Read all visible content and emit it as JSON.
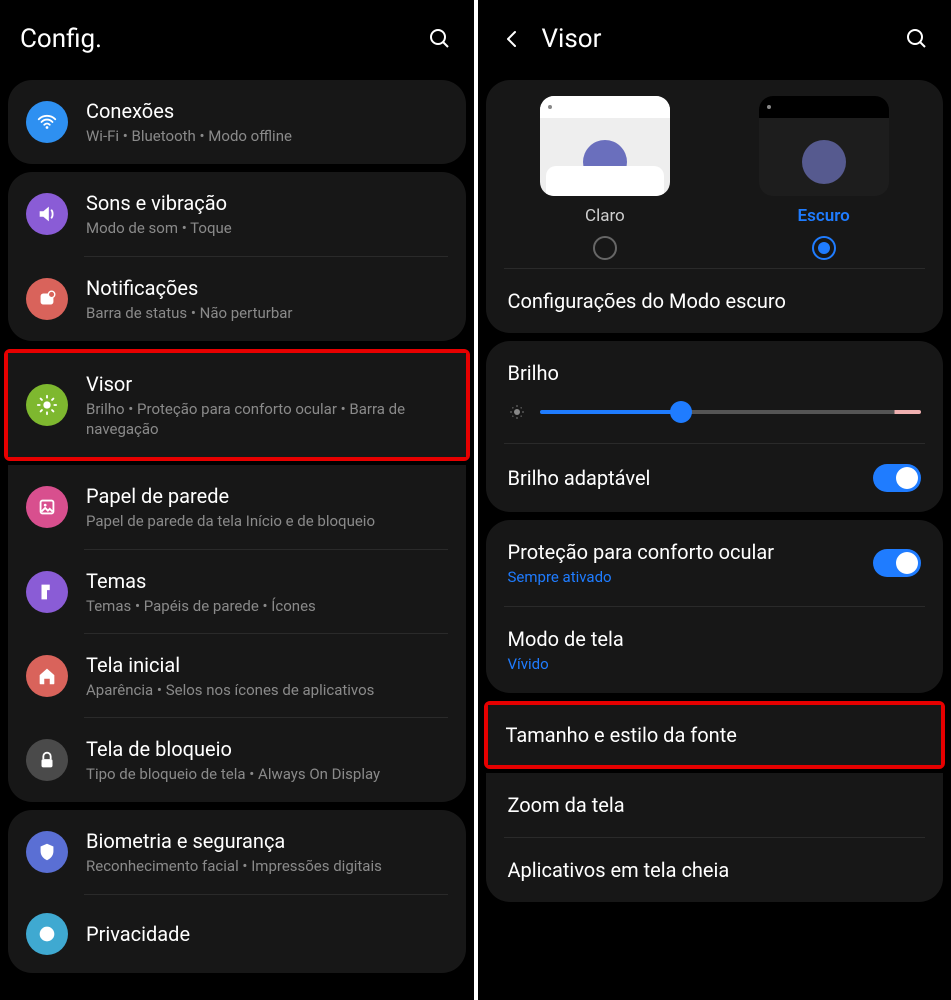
{
  "left": {
    "title": "Config.",
    "groups": [
      {
        "items": [
          {
            "icon": "wifi",
            "color": "#2e90f1",
            "title": "Conexões",
            "sub": "Wi-Fi  •  Bluetooth  •  Modo offline"
          }
        ]
      },
      {
        "items": [
          {
            "icon": "sound",
            "color": "#8a5cd6",
            "title": "Sons e vibração",
            "sub": "Modo de som  •  Toque"
          },
          {
            "icon": "notif",
            "color": "#d9635b",
            "title": "Notificações",
            "sub": "Barra de status  •  Não perturbar"
          }
        ]
      },
      {
        "highlight_index": 0,
        "items": [
          {
            "icon": "display",
            "color": "#7eb82f",
            "title": "Visor",
            "sub": "Brilho  •  Proteção para conforto ocular  •  Barra de navegação"
          },
          {
            "icon": "wallpaper",
            "color": "#d84f8e",
            "title": "Papel de parede",
            "sub": "Papel de parede da tela Início e de bloqueio"
          },
          {
            "icon": "themes",
            "color": "#8a5cd6",
            "title": "Temas",
            "sub": "Temas  •  Papéis de parede  •  Ícones"
          },
          {
            "icon": "home",
            "color": "#d9635b",
            "title": "Tela inicial",
            "sub": "Aparência  •  Selos nos ícones de aplicativos"
          },
          {
            "icon": "lock",
            "color": "#4a4a4a",
            "title": "Tela de bloqueio",
            "sub": "Tipo de bloqueio de tela  •  Always On Display"
          }
        ]
      },
      {
        "items": [
          {
            "icon": "shield",
            "color": "#5a6fd4",
            "title": "Biometria e segurança",
            "sub": "Reconhecimento facial  •  Impressões digitais"
          },
          {
            "icon": "privacy",
            "color": "#3fa9d1",
            "title": "Privacidade",
            "sub": ""
          }
        ]
      }
    ]
  },
  "right": {
    "title": "Visor",
    "theme": {
      "light_label": "Claro",
      "dark_label": "Escuro",
      "selected": "dark"
    },
    "dark_mode_settings": "Configurações do Modo escuro",
    "brightness_label": "Brilho",
    "brightness_value": 37,
    "adaptive_brightness": {
      "label": "Brilho adaptável",
      "on": true
    },
    "eye_comfort": {
      "label": "Proteção para conforto ocular",
      "value": "Sempre ativado",
      "on": true
    },
    "screen_mode": {
      "label": "Modo de tela",
      "value": "Vívido"
    },
    "font_size_style": "Tamanho e estilo da fonte",
    "screen_zoom": "Zoom da tela",
    "fullscreen_apps": "Aplicativos em tela cheia"
  }
}
